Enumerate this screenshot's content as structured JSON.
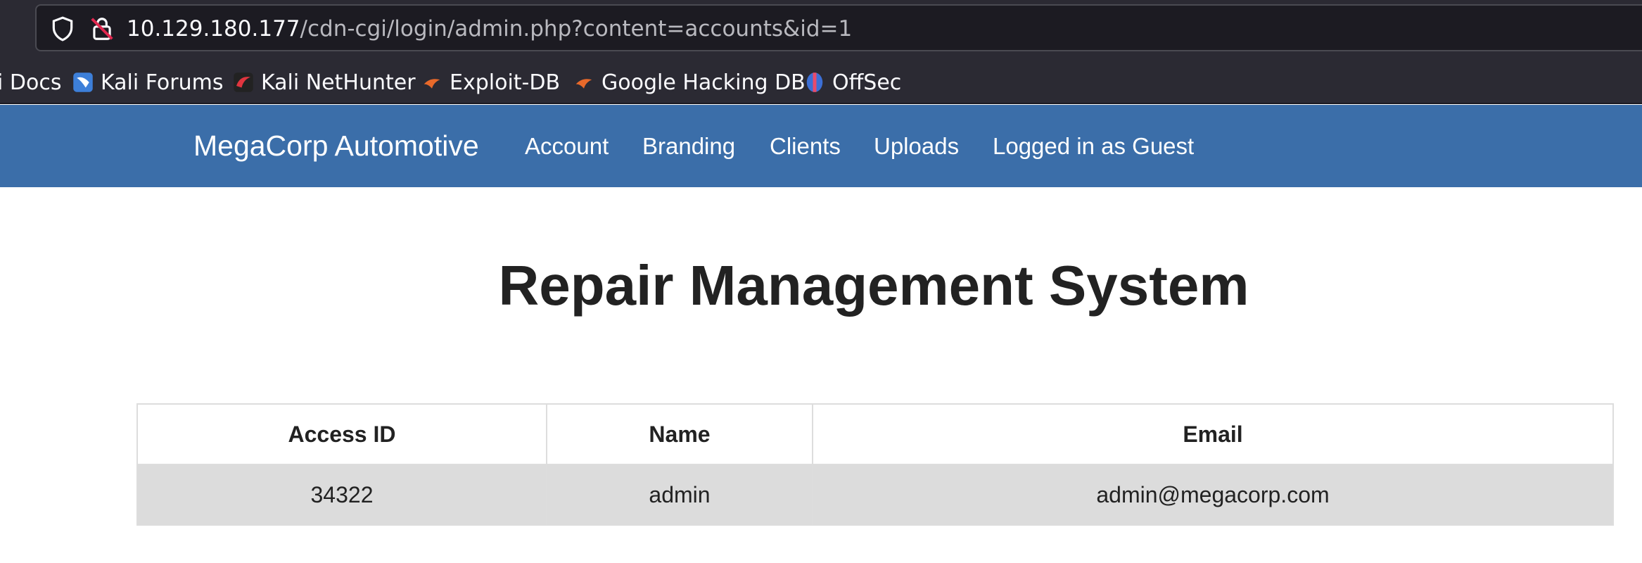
{
  "browser": {
    "url_host": "10.129.180.177",
    "url_path": "/cdn-cgi/login/admin.php?content=accounts&id=1",
    "bookmarks": [
      {
        "label": "i Docs"
      },
      {
        "label": "Kali Forums"
      },
      {
        "label": "Kali NetHunter"
      },
      {
        "label": "Exploit-DB"
      },
      {
        "label": "Google Hacking DB"
      },
      {
        "label": "OffSec"
      }
    ]
  },
  "navbar": {
    "brand": "MegaCorp Automotive",
    "links": [
      "Account",
      "Branding",
      "Clients",
      "Uploads",
      "Logged in as Guest"
    ]
  },
  "main": {
    "title": "Repair Management System",
    "table": {
      "headers": [
        "Access ID",
        "Name",
        "Email"
      ],
      "rows": [
        [
          "34322",
          "admin",
          "admin@megacorp.com"
        ]
      ]
    }
  },
  "colors": {
    "navbar": "#3b6ea9",
    "browser_chrome": "#2b2a33",
    "row_background": "#dcdcdc"
  }
}
